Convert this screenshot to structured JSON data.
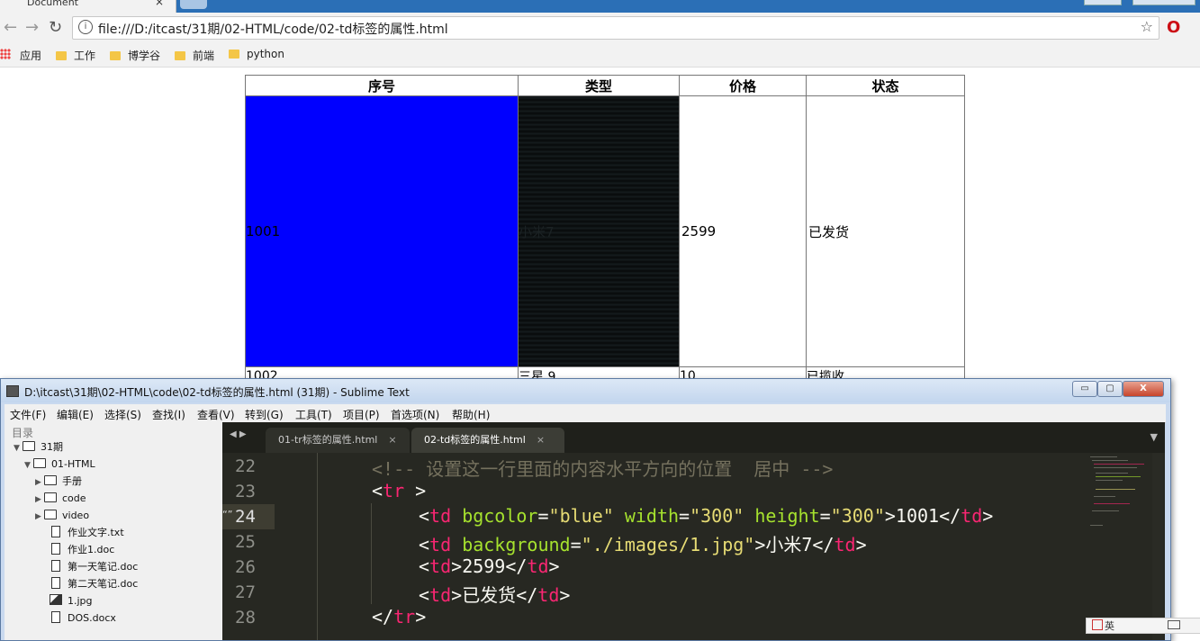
{
  "browser": {
    "tab_title": "Document",
    "tab_close": "×",
    "url": "file:///D:/itcast/31期/02-HTML/code/02-td标签的属性.html",
    "info_icon": "i",
    "bookmark_star": "☆",
    "opera_icon": "O",
    "apps_label": "应用",
    "bookmarks": [
      "工作",
      "博学谷",
      "前端",
      "python"
    ]
  },
  "table": {
    "headers": [
      "序号",
      "类型",
      "价格",
      "状态"
    ],
    "row1": {
      "id": "1001",
      "type": "小米7",
      "price": "2599",
      "status": "已发货"
    },
    "row2": {
      "id": "1002",
      "type": "三星 9",
      "price": "10",
      "status": "已揽收"
    },
    "colors": {
      "cell_blue": "#0000ff"
    }
  },
  "sublime": {
    "title": "D:\\itcast\\31期\\02-HTML\\code\\02-td标签的属性.html (31期) - Sublime Text",
    "window_buttons": {
      "min": "▭",
      "max": "▢",
      "close": "X"
    },
    "menu": [
      "文件(F)",
      "编辑(E)",
      "选择(S)",
      "查找(I)",
      "查看(V)",
      "转到(G)",
      "工具(T)",
      "项目(P)",
      "首选项(N)",
      "帮助(H)"
    ],
    "sidebar": {
      "header": "目录",
      "items": [
        {
          "label": "31期",
          "kind": "folder-open"
        },
        {
          "label": "01-HTML",
          "kind": "folder-open"
        },
        {
          "label": "手册",
          "kind": "folder"
        },
        {
          "label": "code",
          "kind": "folder"
        },
        {
          "label": "video",
          "kind": "folder"
        },
        {
          "label": "作业文字.txt",
          "kind": "file"
        },
        {
          "label": "作业1.doc",
          "kind": "file"
        },
        {
          "label": "第一天笔记.doc",
          "kind": "file"
        },
        {
          "label": "第二天笔记.doc",
          "kind": "file"
        },
        {
          "label": "1.jpg",
          "kind": "image"
        },
        {
          "label": "DOS.docx",
          "kind": "file"
        }
      ]
    },
    "tabs": [
      {
        "label": "01-tr标签的属性.html",
        "close": "×",
        "active": false
      },
      {
        "label": "02-td标签的属性.html",
        "close": "×",
        "active": true
      }
    ],
    "tab_nav": "◀ ▶",
    "tab_menu": "▼",
    "line_numbers": [
      "22",
      "23",
      "24",
      "25",
      "26",
      "27",
      "28"
    ],
    "code": {
      "l22": "<!-- 设置这一行里面的内容水平方向的位置  居中 -->",
      "l23_tag": "tr",
      "l24": {
        "tag": "td",
        "a1": "bgcolor",
        "v1": "\"blue\"",
        "a2": "width",
        "v2": "\"300\"",
        "a3": "height",
        "v3": "\"300\"",
        "text": "1001"
      },
      "l25": {
        "tag": "td",
        "a1": "background",
        "v1": "\"./images/1.jpg\"",
        "text": "小米7"
      },
      "l26": {
        "tag": "td",
        "text": "2599"
      },
      "l27": {
        "tag": "td",
        "text": "已发货"
      },
      "l28_tag": "tr"
    },
    "gutter_marker": "“”"
  },
  "ime": {
    "text": "英"
  }
}
